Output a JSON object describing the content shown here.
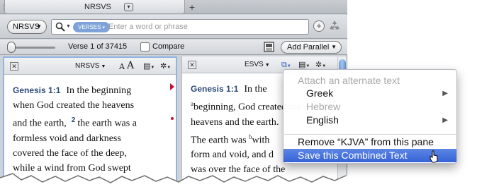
{
  "tab": {
    "title": "NRSVS",
    "close_glyph": "×",
    "dropdown_glyph": "▾",
    "new_tab_glyph": "+"
  },
  "toolbar": {
    "resource_button": "NRSVS",
    "verses_pill": "VERSES",
    "search_placeholder": "Enter a word or phrase",
    "add_glyph": "+"
  },
  "navbar": {
    "verse_position": "Verse 1 of 37415",
    "compare_label": "Compare",
    "add_parallel_label": "Add Parallel"
  },
  "left_pane": {
    "resource": "NRSVS",
    "font_small": "A",
    "font_large": "A",
    "reference": "Genesis 1:1",
    "lines": [
      "In the beginning",
      "when God created the heavens",
      "and the earth,",
      "the earth was a",
      "formless void and darkness",
      "covered the face of the deep,",
      "while a wind from God swept"
    ],
    "verse_number_2": "2"
  },
  "right_pane": {
    "resource": "ESVS",
    "reference": "Genesis 1:1",
    "lines": [
      "In the",
      "beginning, God created the",
      "heavens and the earth.",
      "The earth was",
      "with",
      "form and void, and d",
      "was over the face of the"
    ],
    "footnote_a": "a",
    "footnote_b": "b"
  },
  "menu": {
    "header": "Attach an alternate text",
    "greek": "Greek",
    "hebrew": "Hebrew",
    "english": "English",
    "remove": "Remove “KJVA” from this pane",
    "save": "Save this Combined Text",
    "submenu_arrow": "▶"
  },
  "colors": {
    "accent": "#3663d6",
    "reference_blue": "#2c4a7a",
    "marker_red": "#c8102e",
    "pane_border": "#8fb5e3"
  }
}
